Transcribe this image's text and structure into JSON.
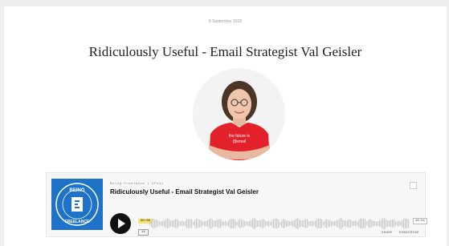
{
  "post": {
    "date": "8 September 2018",
    "title": "Ridiculously Useful - Email Strategist Val Geisler"
  },
  "avatar": {
    "shirt_text": "the future is [f]email",
    "shirt_color": "#e3212b"
  },
  "player": {
    "cover_text": "BEING FREELANCE",
    "meta": "Being Freelance | EP141",
    "episode_title": "Ridiculously Useful - Email Strategist Val Geisler",
    "current_time": "00:00",
    "speed": "1X",
    "total_time": "45:51",
    "actions": {
      "share": "SHARE",
      "subscribe": "SUBSCRIBE"
    },
    "colors": {
      "accent": "#f7e26b",
      "cover": "#1e73c9"
    }
  }
}
